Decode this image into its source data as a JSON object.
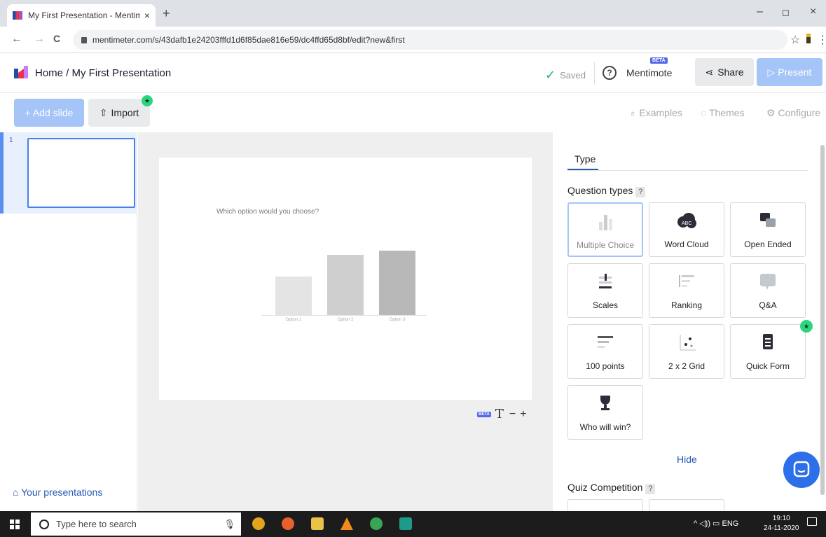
{
  "browser": {
    "tab_title": "My First Presentation - Mentime",
    "new_tab": "+",
    "close_tab": "×",
    "minimize": "–",
    "restore": "◻",
    "close": "×",
    "back": "←",
    "forward": "→",
    "reload": "C",
    "url": "mentimeter.com/s/43dafb1e24203fffd1d6f85dae816e59/dc4ffd65d8bf/edit?new&first",
    "star": "☆",
    "menu": "⋮"
  },
  "header": {
    "breadcrumb": "Home / My First Presentation",
    "saved": "Saved",
    "help": "?",
    "mentimote": "Mentimote",
    "beta": "BETA",
    "share": "Share",
    "present": "▷ Present"
  },
  "toolbar": {
    "add_slide": "+ Add slide",
    "import": "Import",
    "examples": "Examples",
    "themes": "Themes",
    "configure": "Configure"
  },
  "slides_panel": {
    "slide_number": "1",
    "your_presentations": "Your presentations"
  },
  "slide": {
    "question": "Which option would you choose?",
    "chart_data": {
      "type": "bar",
      "categories": [
        "Option 1",
        "Option 2",
        "Option 3"
      ],
      "values": [
        0.48,
        0.75,
        0.8
      ],
      "colors": [
        "#e4e4e4",
        "#cfcfcf",
        "#b8b8b8"
      ]
    }
  },
  "format_bar": {
    "beta": "BETA",
    "text": "T",
    "minus": "−",
    "plus": "+"
  },
  "right_panel": {
    "tab": "Type",
    "question_types_label": "Question types",
    "help": "?",
    "question_types": [
      {
        "label": "Multiple Choice",
        "icon": "bar-chart-icon"
      },
      {
        "label": "Word Cloud",
        "icon": "word-cloud-icon"
      },
      {
        "label": "Open Ended",
        "icon": "speech-bubbles-icon"
      },
      {
        "label": "Scales",
        "icon": "scales-icon"
      },
      {
        "label": "Ranking",
        "icon": "ranking-icon"
      },
      {
        "label": "Q&A",
        "icon": "qa-bubble-icon"
      },
      {
        "label": "100 points",
        "icon": "points-icon"
      },
      {
        "label": "2 x 2 Grid",
        "icon": "grid-icon"
      },
      {
        "label": "Quick Form",
        "icon": "form-icon"
      },
      {
        "label": "Who will win?",
        "icon": "trophy-icon"
      }
    ],
    "hide": "Hide",
    "quiz_competition_label": "Quiz Competition"
  },
  "taskbar": {
    "search_placeholder": "Type here to search",
    "tray": "^ ◁)) ▭ ENG",
    "time": "19:10",
    "date": "24-11-2020"
  }
}
